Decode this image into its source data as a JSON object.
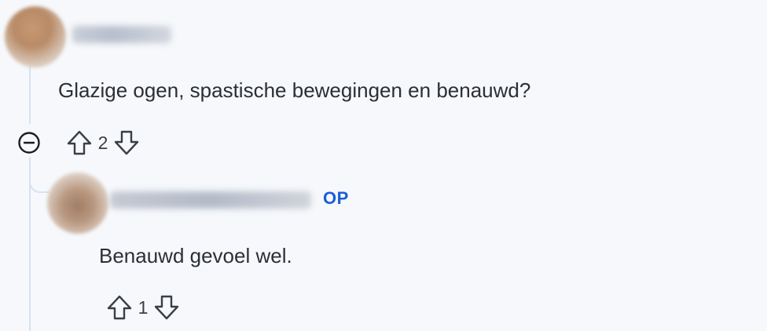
{
  "comments": [
    {
      "username": "user_redacted",
      "text": "Glazige ogen, spastische bewegingen en benauwd?",
      "votes": "2"
    },
    {
      "username": "op_user_redacted",
      "badge": "OP",
      "text": "Benauwd gevoel wel.",
      "votes": "1"
    }
  ],
  "colors": {
    "accent": "#1a5ed6",
    "thread_line": "#d6e2f0",
    "background": "#f6f8fb"
  },
  "icons": {
    "collapse": "minus-circle-icon",
    "upvote": "upvote-arrow-icon",
    "downvote": "downvote-arrow-icon"
  }
}
